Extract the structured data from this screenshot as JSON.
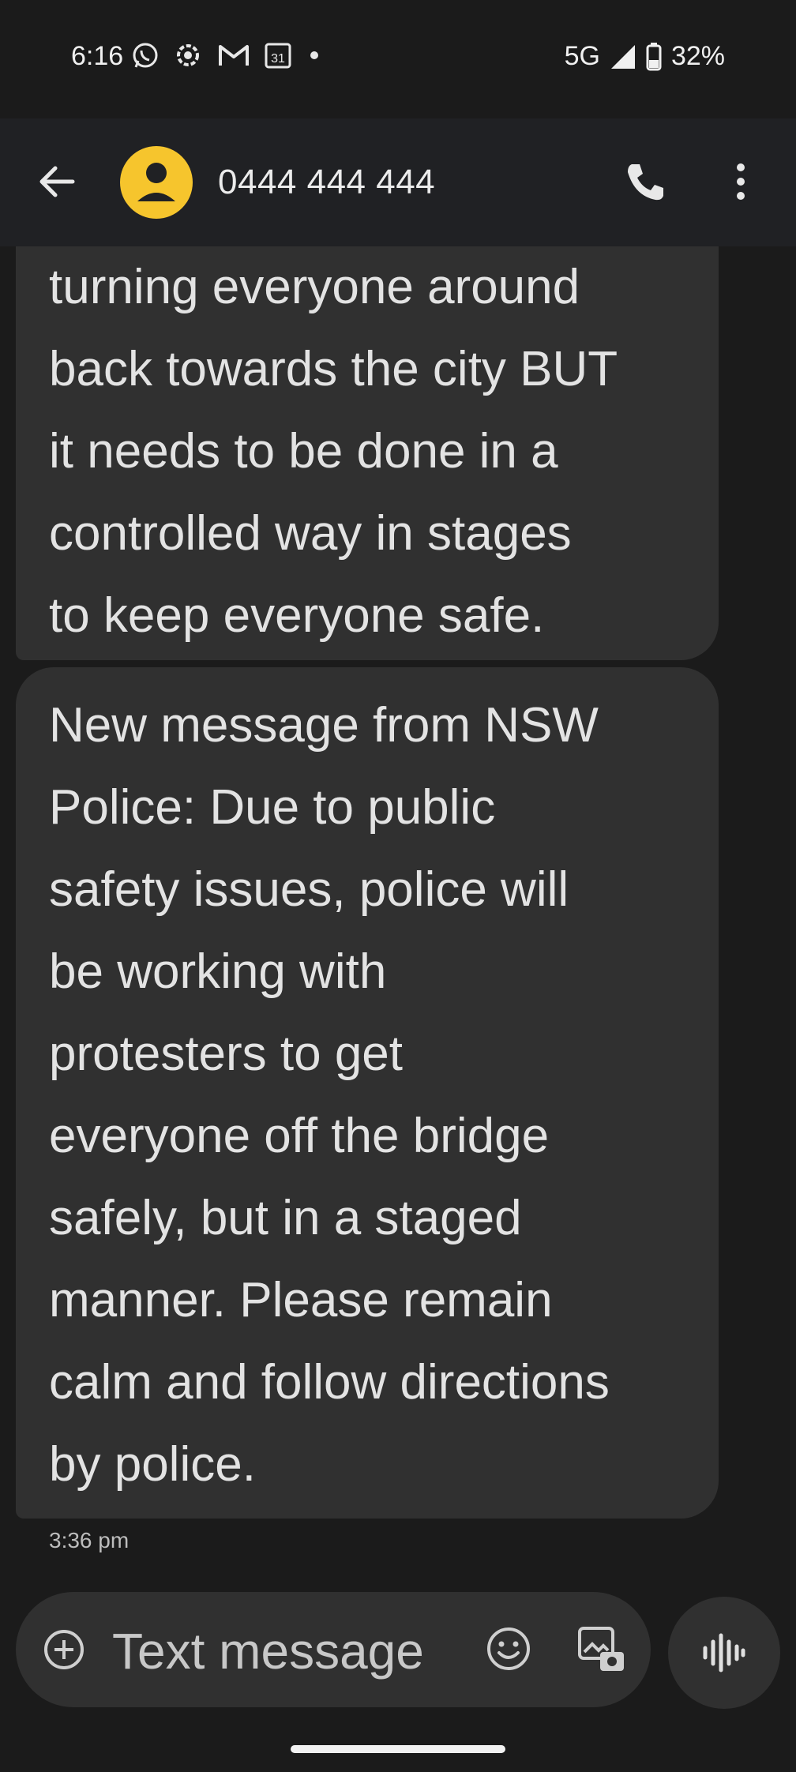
{
  "status_bar": {
    "time": "6:16",
    "icons": [
      "whatsapp-icon",
      "bubbles-icon",
      "gmail-icon",
      "calendar-icon",
      "dot-icon"
    ],
    "calendar_day": "31",
    "network": "5G",
    "battery": "32%"
  },
  "header": {
    "contact": "0444 444 444",
    "avatar_color": "#f6c52d"
  },
  "messages": [
    {
      "lines": [
        "turning everyone around",
        "back towards the city BUT",
        "it needs to be done in a",
        "controlled way in stages",
        "to keep everyone safe."
      ]
    },
    {
      "lines": [
        "New message from NSW",
        "Police: Due to public",
        "safety issues, police will",
        "be working with",
        "protesters to get",
        "everyone off the bridge",
        "safely, but in a staged",
        "manner. Please remain",
        "calm and follow directions",
        "by police."
      ],
      "timestamp": "3:36 pm"
    }
  ],
  "compose": {
    "placeholder": "Text message"
  }
}
